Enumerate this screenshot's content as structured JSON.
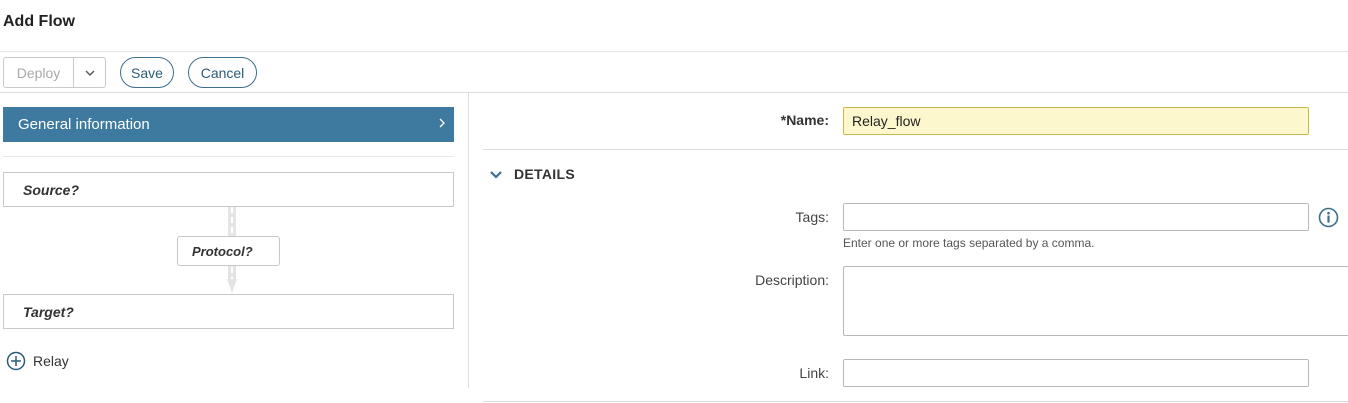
{
  "page": {
    "title": "Add Flow"
  },
  "toolbar": {
    "deploy_label": "Deploy",
    "deploy_menu_icon": "chevron-down-icon",
    "save_label": "Save",
    "cancel_label": "Cancel"
  },
  "flow_panel": {
    "general_info_label": "General information",
    "general_info_icon": "chevron-right-icon",
    "source_label": "Source?",
    "protocol_label": "Protocol?",
    "target_label": "Target?",
    "add_relay_label": "Relay",
    "add_relay_icon": "plus-circle-icon"
  },
  "form": {
    "name_label": "*Name:",
    "name_value": "Relay_flow",
    "details_header": "DETAILS",
    "tags_label": "Tags:",
    "tags_value": "",
    "tags_hint": "Enter one or more tags separated by a comma.",
    "description_label": "Description:",
    "description_value": "",
    "link_label": "Link:",
    "link_value": ""
  },
  "colors": {
    "accent": "#3e7aa0",
    "button_outline": "#3e6f8f",
    "name_field_bg": "#fdf7cd"
  }
}
